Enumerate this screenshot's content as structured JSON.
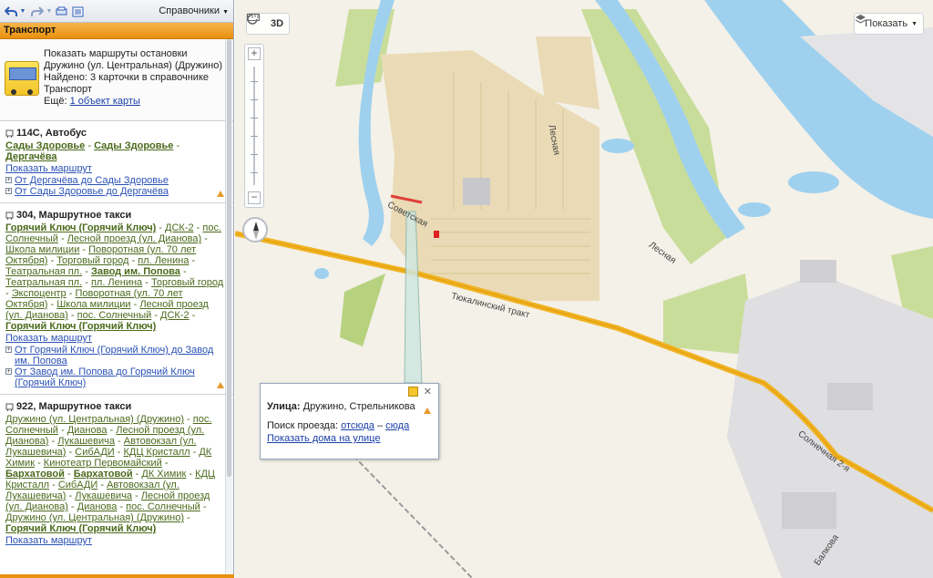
{
  "toolbar": {
    "back_icon": "back-arrow-icon",
    "forward_icon": "forward-arrow-icon",
    "directory_dropdown": "Справочники"
  },
  "panel": {
    "header": "Транспорт",
    "summary": {
      "line1": "Показать маршруты остановки Дружино (ул. Центральная) (Дружино)",
      "line2": "Найдено: 3 карточки в справочнике Транспорт",
      "more_prefix": "Ещё:",
      "more_link": "1 объект карты"
    },
    "routes": [
      {
        "title": "114С, Автобус",
        "stops": [
          {
            "t": "Сады Здоровье",
            "b": true
          },
          {
            "t": "Сады Здоровье",
            "b": true
          },
          {
            "t": "Дергачёва",
            "b": true
          }
        ],
        "show_route": "Показать маршрут",
        "directions": [
          "От Дергачёва до Сады Здоровье",
          "От Сады Здоровье до Дергачёва"
        ]
      },
      {
        "title": "304, Маршрутное такси",
        "stops": [
          {
            "t": "Горячий Ключ (Горячий Ключ)",
            "b": true
          },
          {
            "t": "ДСК-2"
          },
          {
            "t": "пос. Солнечный"
          },
          {
            "t": "Лесной проезд (ул. Дианова)"
          },
          {
            "t": "Школа милиции"
          },
          {
            "t": "Поворотная (ул. 70 лет Октября)"
          },
          {
            "t": "Торговый город"
          },
          {
            "t": "пл. Ленина"
          },
          {
            "t": "Театральная пл."
          },
          {
            "t": "Завод им. Попова",
            "b": true
          },
          {
            "t": "Театральная пл."
          },
          {
            "t": "пл. Ленина"
          },
          {
            "t": "Торговый город"
          },
          {
            "t": "Экспоцентр"
          },
          {
            "t": "Поворотная (ул. 70 лет Октября)"
          },
          {
            "t": "Школа милиции"
          },
          {
            "t": "Лесной проезд (ул. Дианова)"
          },
          {
            "t": "пос. Солнечный"
          },
          {
            "t": "ДСК-2"
          },
          {
            "t": "Горячий Ключ (Горячий Ключ)",
            "b": true
          }
        ],
        "show_route": "Показать маршрут",
        "directions": [
          "От Горячий Ключ (Горячий Ключ) до Завод им. Попова",
          "От Завод им. Попова до Горячий Ключ (Горячий Ключ)"
        ]
      },
      {
        "title": "922, Маршрутное такси",
        "stops": [
          {
            "t": "Дружино (ул. Центральная) (Дружино)"
          },
          {
            "t": "пос. Солнечный"
          },
          {
            "t": "Дианова"
          },
          {
            "t": "Лесной проезд (ул. Дианова)"
          },
          {
            "t": "Лукашевича"
          },
          {
            "t": "Автовокзал (ул. Лукашевича)"
          },
          {
            "t": "СибАДИ"
          },
          {
            "t": "КДЦ Кристалл"
          },
          {
            "t": "ДК Химик"
          },
          {
            "t": "Кинотеатр Первомайский"
          },
          {
            "t": "Бархатовой",
            "b": true
          },
          {
            "t": "Бархатовой",
            "b": true
          },
          {
            "t": "ДК Химик"
          },
          {
            "t": "КДЦ Кристалл"
          },
          {
            "t": "СибАДИ"
          },
          {
            "t": "Автовокзал (ул. Лукашевича)"
          },
          {
            "t": "Лукашевича"
          },
          {
            "t": "Лесной проезд (ул. Дианова)"
          },
          {
            "t": "Дианова"
          },
          {
            "t": "пос. Солнечный"
          },
          {
            "t": "Дружино (ул. Центральная) (Дружино)"
          },
          {
            "t": "Горячий Ключ (Горячий Ключ)",
            "b": true
          }
        ],
        "show_route": "Показать маршрут",
        "directions": []
      }
    ]
  },
  "map": {
    "tools": {
      "ruler_icon": "ruler-icon",
      "lasso_icon": "lasso-icon",
      "view3d": "3D"
    },
    "layers_button": "Показать",
    "zoom_in": "+",
    "zoom_out": "−",
    "labels": {
      "sovetskaya": "Советская",
      "lesnaya1": "Лесная",
      "lesnaya2": "Лесная",
      "tyukalinsky": "Тюкалинский тракт",
      "solnechnaya": "Солнечная 2-я",
      "balnaya": "Балкова"
    },
    "popup": {
      "street_label": "Улица:",
      "street_value": "Дружино, Стрельникова",
      "search_prefix": "Поиск проезда:",
      "from_here": "отсюда",
      "dash": "–",
      "to_here": "сюда",
      "show_houses": "Показать дома на улице"
    }
  }
}
